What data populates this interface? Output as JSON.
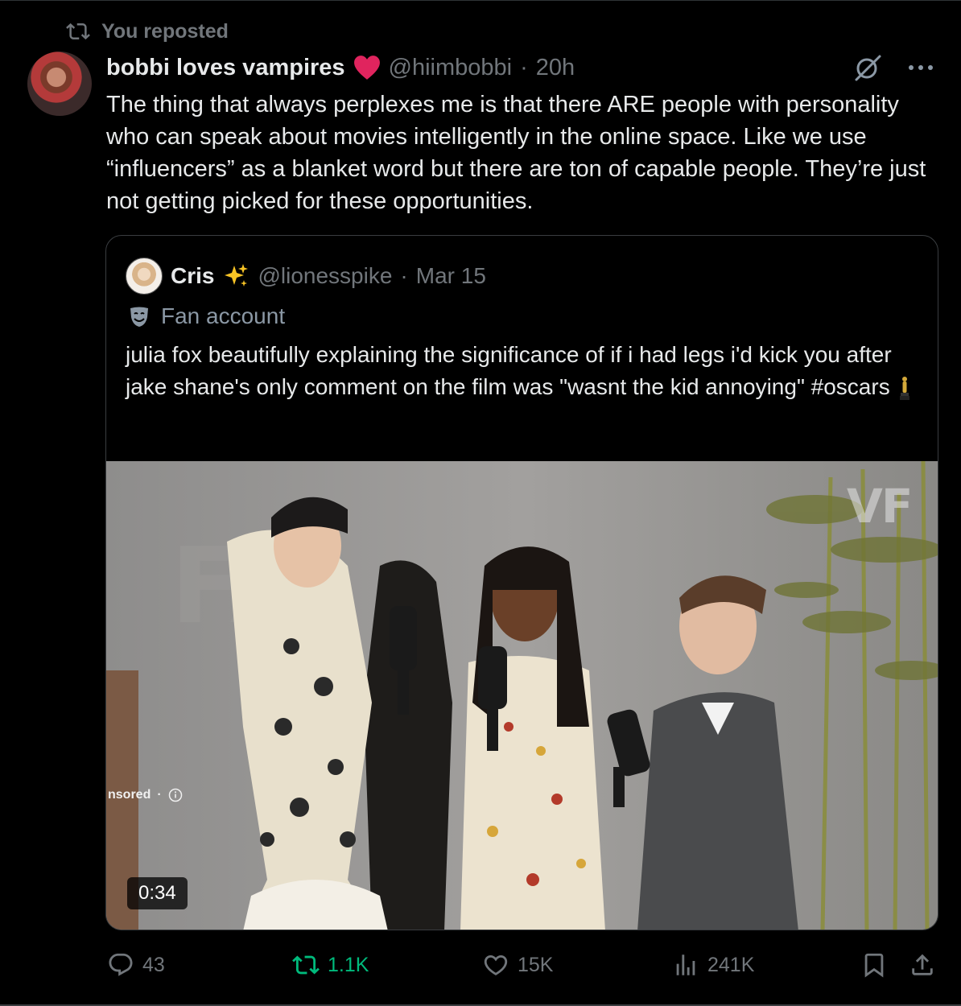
{
  "repost_banner": {
    "text": "You reposted"
  },
  "tweet": {
    "author_name": "bobbi loves vampires",
    "handle": "@hiimbobbi",
    "separator": "·",
    "time": "20h",
    "text": "The thing that always perplexes me is that there ARE people with personality who can speak about movies intelligently in the online space. Like we use “influencers” as a blanket word but there are ton of capable people. They’re just not getting picked for these opportunities."
  },
  "quote": {
    "author_name": "Cris",
    "handle": "@lionesspike",
    "separator": "·",
    "date": "Mar 15",
    "badge": "Fan account",
    "text": "julia fox beautifully explaining the significance of if i had legs i'd kick you after jake shane's only comment on the film was \"wasnt the kid annoying\" #oscars",
    "video": {
      "watermark": "VF",
      "mic_label": "VF",
      "sponsored": "nsored",
      "sponsored_dot": "·",
      "duration": "0:34"
    }
  },
  "actions": {
    "replies": "43",
    "reposts": "1.1K",
    "likes": "15K",
    "views": "241K"
  },
  "colors": {
    "background": "#000000",
    "text": "#e7e9ea",
    "muted": "#71767b",
    "repost_green": "#00ba7c",
    "heart_red": "#e0245e",
    "border": "#2f3336"
  }
}
